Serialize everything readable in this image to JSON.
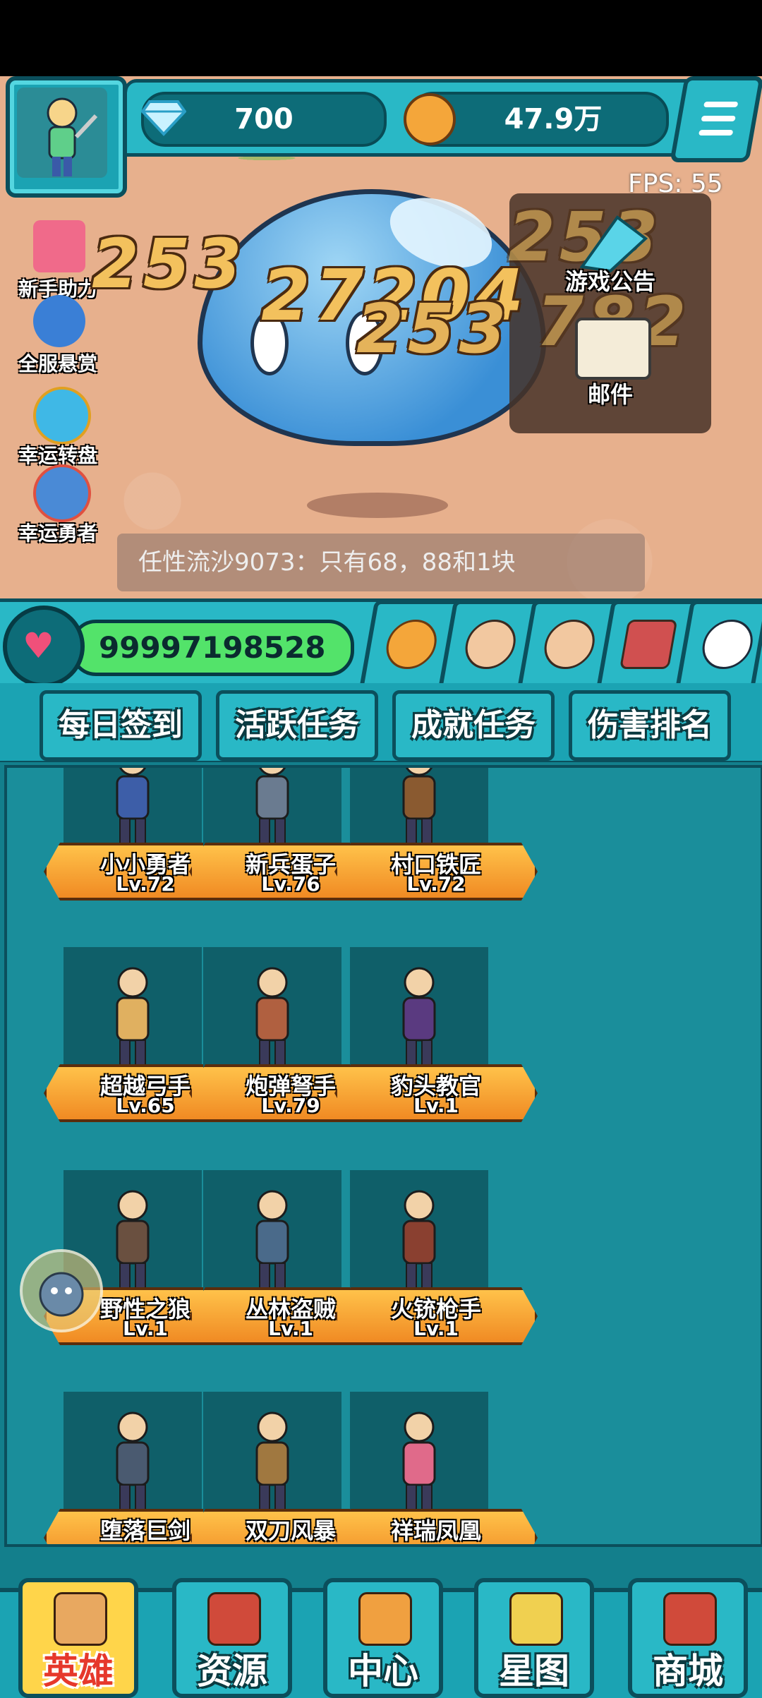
{
  "top_bar": {
    "diamonds": "700",
    "coins": "47.9万",
    "fps_label": "FPS:",
    "fps_value": "55"
  },
  "side_menu": [
    {
      "label": "新手助力",
      "icon": "gift-icon",
      "color": "#f06a8a"
    },
    {
      "label": "全服悬赏",
      "icon": "bounty-icon",
      "color": "#3a7fd6"
    },
    {
      "label": "幸运转盘",
      "icon": "wheel-icon",
      "color": "#3fb8e6"
    },
    {
      "label": "幸运勇者",
      "icon": "lucky-hero-icon",
      "color": "#e05040"
    }
  ],
  "battle": {
    "damage_numbers": [
      "253",
      "27204",
      "253",
      "253",
      "782"
    ]
  },
  "right_panel": {
    "announcement_label": "游戏公告",
    "mail_label": "邮件"
  },
  "chat": {
    "message": "任性流沙9073：只有68，88和1块"
  },
  "hp": {
    "value": "99997198528",
    "color": "#53e36a"
  },
  "quick_buttons": [
    {
      "icon": "coin-plus-icon"
    },
    {
      "icon": "hand-plus-icon"
    },
    {
      "icon": "fist-icon"
    },
    {
      "icon": "chest-plus-icon"
    },
    {
      "icon": "chat-icon"
    }
  ],
  "tabs": [
    {
      "label": "每日签到"
    },
    {
      "label": "活跃任务"
    },
    {
      "label": "成就任务"
    },
    {
      "label": "伤害排名"
    }
  ],
  "heroes": [
    {
      "name": "小小勇者",
      "level": "Lv.72",
      "color": "#3d5ea8"
    },
    {
      "name": "新兵蛋子",
      "level": "Lv.76",
      "color": "#6a7b90"
    },
    {
      "name": "村口铁匠",
      "level": "Lv.72",
      "color": "#8a5a30"
    },
    {
      "name": "超越弓手",
      "level": "Lv.65",
      "color": "#e0b060"
    },
    {
      "name": "炮弹弩手",
      "level": "Lv.79",
      "color": "#b06040"
    },
    {
      "name": "豹头教官",
      "level": "Lv.1",
      "color": "#5a3a80"
    },
    {
      "name": "野性之狼",
      "level": "Lv.1",
      "color": "#6a5040"
    },
    {
      "name": "丛林盗贼",
      "level": "Lv.1",
      "color": "#4a6a8a"
    },
    {
      "name": "火铳枪手",
      "level": "Lv.1",
      "color": "#8a4030"
    },
    {
      "name": "堕落巨剑",
      "level": "",
      "color": "#4a5a70"
    },
    {
      "name": "双刀风暴",
      "level": "",
      "color": "#a07840"
    },
    {
      "name": "祥瑞凤凰",
      "level": "",
      "color": "#e06a8a"
    }
  ],
  "bottom_nav": [
    {
      "label": "英雄",
      "icon": "scroll-icon",
      "active": true
    },
    {
      "label": "资源",
      "icon": "castle-icon",
      "active": false
    },
    {
      "label": "中心",
      "icon": "signpost-icon",
      "active": false
    },
    {
      "label": "星图",
      "icon": "star-icon",
      "active": false
    },
    {
      "label": "商城",
      "icon": "shop-icon",
      "active": false
    }
  ]
}
